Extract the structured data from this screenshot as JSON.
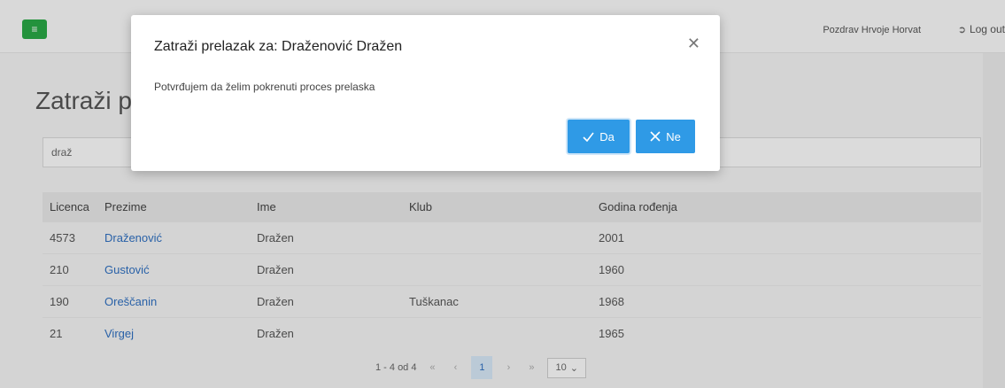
{
  "navbar": {
    "menu_icon": "hamburger-icon",
    "greeting": "Pozdrav Hrvoje Horvat",
    "logout_label": "Log out",
    "logout_icon": "logout-icon"
  },
  "page": {
    "title": "Zatraži pr"
  },
  "search": {
    "value": "draž"
  },
  "table": {
    "headers": [
      "Licenca",
      "Prezime",
      "Ime",
      "Klub",
      "Godina rođenja"
    ],
    "rows": [
      {
        "licenca": "4573",
        "prezime": "Draženović",
        "ime": "Dražen",
        "klub": "",
        "godina": "2001"
      },
      {
        "licenca": "210",
        "prezime": "Gustović",
        "ime": "Dražen",
        "klub": "",
        "godina": "1960"
      },
      {
        "licenca": "190",
        "prezime": "Oreščanin",
        "ime": "Dražen",
        "klub": "Tuškanac",
        "godina": "1968"
      },
      {
        "licenca": "21",
        "prezime": "Virgej",
        "ime": "Dražen",
        "klub": "",
        "godina": "1965"
      }
    ]
  },
  "pagination": {
    "summary": "1 - 4 od 4",
    "first": "«",
    "prev": "‹",
    "current": "1",
    "next": "›",
    "last": "»",
    "page_size": "10"
  },
  "modal": {
    "title": "Zatraži prelazak za: Draženović Dražen",
    "body": "Potvrđujem da želim pokrenuti proces prelaska",
    "yes_label": "Da",
    "no_label": "Ne",
    "accent": "#2f9ae6"
  }
}
